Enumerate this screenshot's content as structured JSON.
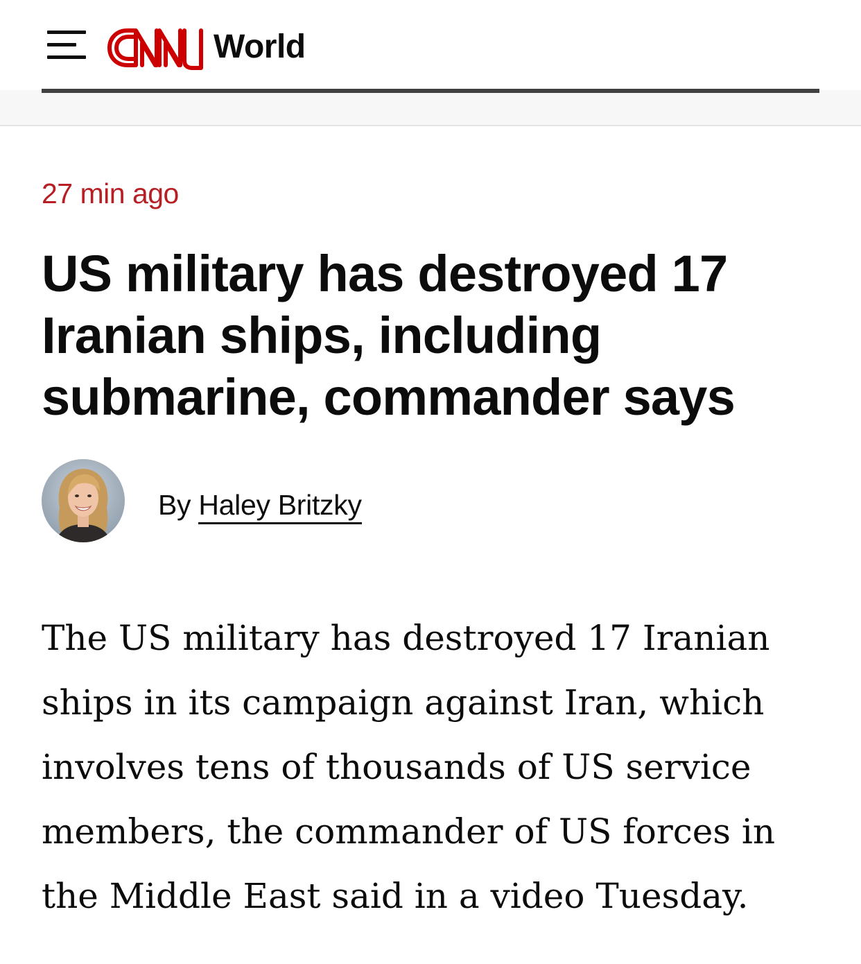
{
  "header": {
    "menu_icon": "hamburger-menu-icon",
    "logo_text": "CNN",
    "section": "World"
  },
  "colors": {
    "brand_red": "#cc0000",
    "timestamp_red": "#b81f24",
    "text": "#0c0c0c"
  },
  "article": {
    "timestamp": "27 min ago",
    "headline": "US military has destroyed 17 Iranian ships, including submarine, commander says",
    "byline_prefix": "By",
    "author": "Haley Britzky",
    "author_avatar": "author-photo",
    "body": "The US military has destroyed 17 Iranian ships in its campaign against Iran, which involves tens of thousands of US service members, the commander of US forces in the Middle East said in a video Tuesday."
  }
}
